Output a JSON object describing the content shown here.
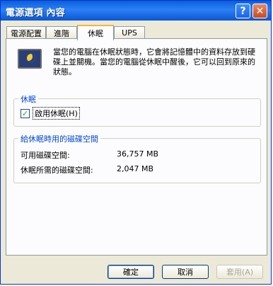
{
  "window": {
    "title": "電源選項 內容"
  },
  "titlebar_buttons": {
    "help": "?",
    "close": "✕"
  },
  "tabs": [
    {
      "label": "電源配置"
    },
    {
      "label": "進階"
    },
    {
      "label": "休眠"
    },
    {
      "label": "UPS"
    }
  ],
  "active_tab": "休眠",
  "hibernate": {
    "description": "當您的電腦在休眠狀態時，它會將記憶體中的資料存放到硬碟上並關機。當您的電腦從休眠中醒後，它可以回到原來的狀態。",
    "group_title": "休眠",
    "checkbox_label": "啟用休眠(H)",
    "checkbox_checked": true
  },
  "disk_space": {
    "group_title": "給休眠時用的磁碟空間",
    "free_label": "可用磁碟空間:",
    "free_value": "36,757 MB",
    "required_label": "休眠所需的磁碟空間:",
    "required_value": "2,047 MB"
  },
  "buttons": {
    "ok": "確定",
    "cancel": "取消",
    "apply": "套用(A)"
  },
  "icons": {
    "hibernate": "hibernate-monitor-icon",
    "checkmark": "check-icon"
  }
}
